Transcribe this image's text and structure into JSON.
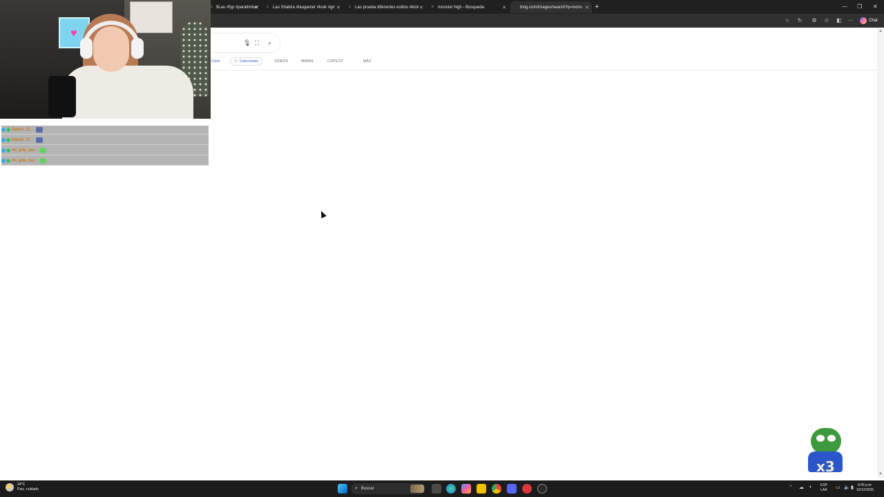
{
  "browser": {
    "tabs": [
      {
        "label": "9Lau #fyp #paratimixer",
        "icon": "tiktok-icon"
      },
      {
        "label": "Lau Shakira #laugamer #look #gir",
        "icon": "tiktok-icon"
      },
      {
        "label": "Lau prueba diferentes estilos #kick",
        "icon": "tiktok-icon"
      },
      {
        "label": "monster high - Búsqueda",
        "icon": "search-icon"
      },
      {
        "label": "bing.com/images/search?q=mons",
        "icon": "loading-icon"
      }
    ],
    "toolbar": {
      "chat_label": "Chat"
    }
  },
  "bing": {
    "nav": {
      "clear_partial": "Clear",
      "collections": "Colecciones",
      "videos": "VIDEOS",
      "maps": "MAPAS",
      "copilot": "COPILOT",
      "more": "⋮ MÁS"
    }
  },
  "stream_chat": {
    "messages": [
      {
        "user": "DaniA_11 :",
        "emote_color": "#5a6aa8"
      },
      {
        "user": "DaniA_11 :",
        "emote_color": "#5a6aa8"
      },
      {
        "user": "mi_jefa_lau :",
        "emote_color": "#5fd35f"
      },
      {
        "user": "mi_jefa_lau :",
        "emote_color": "#5fd35f"
      }
    ]
  },
  "emote_overlay": {
    "multiplier": "x3"
  },
  "taskbar": {
    "weather_temp": "24°C",
    "weather_desc": "Parc. nublado",
    "search_label": "Buscar",
    "lang_top": "ESP",
    "lang_bottom": "LAA",
    "time": "6:05 p.m.",
    "date": "16/12/2025"
  }
}
